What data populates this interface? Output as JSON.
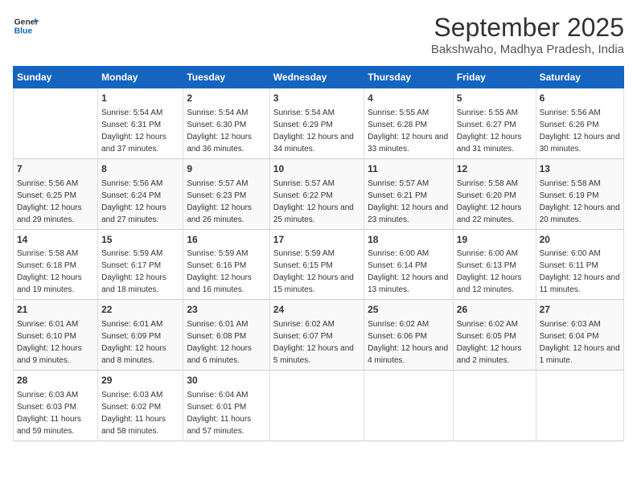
{
  "header": {
    "logo_line1": "General",
    "logo_line2": "Blue",
    "month": "September 2025",
    "location": "Bakshwaho, Madhya Pradesh, India"
  },
  "weekdays": [
    "Sunday",
    "Monday",
    "Tuesday",
    "Wednesday",
    "Thursday",
    "Friday",
    "Saturday"
  ],
  "weeks": [
    [
      {
        "day": "",
        "sunrise": "",
        "sunset": "",
        "daylight": ""
      },
      {
        "day": "1",
        "sunrise": "Sunrise: 5:54 AM",
        "sunset": "Sunset: 6:31 PM",
        "daylight": "Daylight: 12 hours and 37 minutes."
      },
      {
        "day": "2",
        "sunrise": "Sunrise: 5:54 AM",
        "sunset": "Sunset: 6:30 PM",
        "daylight": "Daylight: 12 hours and 36 minutes."
      },
      {
        "day": "3",
        "sunrise": "Sunrise: 5:54 AM",
        "sunset": "Sunset: 6:29 PM",
        "daylight": "Daylight: 12 hours and 34 minutes."
      },
      {
        "day": "4",
        "sunrise": "Sunrise: 5:55 AM",
        "sunset": "Sunset: 6:28 PM",
        "daylight": "Daylight: 12 hours and 33 minutes."
      },
      {
        "day": "5",
        "sunrise": "Sunrise: 5:55 AM",
        "sunset": "Sunset: 6:27 PM",
        "daylight": "Daylight: 12 hours and 31 minutes."
      },
      {
        "day": "6",
        "sunrise": "Sunrise: 5:56 AM",
        "sunset": "Sunset: 6:26 PM",
        "daylight": "Daylight: 12 hours and 30 minutes."
      }
    ],
    [
      {
        "day": "7",
        "sunrise": "Sunrise: 5:56 AM",
        "sunset": "Sunset: 6:25 PM",
        "daylight": "Daylight: 12 hours and 29 minutes."
      },
      {
        "day": "8",
        "sunrise": "Sunrise: 5:56 AM",
        "sunset": "Sunset: 6:24 PM",
        "daylight": "Daylight: 12 hours and 27 minutes."
      },
      {
        "day": "9",
        "sunrise": "Sunrise: 5:57 AM",
        "sunset": "Sunset: 6:23 PM",
        "daylight": "Daylight: 12 hours and 26 minutes."
      },
      {
        "day": "10",
        "sunrise": "Sunrise: 5:57 AM",
        "sunset": "Sunset: 6:22 PM",
        "daylight": "Daylight: 12 hours and 25 minutes."
      },
      {
        "day": "11",
        "sunrise": "Sunrise: 5:57 AM",
        "sunset": "Sunset: 6:21 PM",
        "daylight": "Daylight: 12 hours and 23 minutes."
      },
      {
        "day": "12",
        "sunrise": "Sunrise: 5:58 AM",
        "sunset": "Sunset: 6:20 PM",
        "daylight": "Daylight: 12 hours and 22 minutes."
      },
      {
        "day": "13",
        "sunrise": "Sunrise: 5:58 AM",
        "sunset": "Sunset: 6:19 PM",
        "daylight": "Daylight: 12 hours and 20 minutes."
      }
    ],
    [
      {
        "day": "14",
        "sunrise": "Sunrise: 5:58 AM",
        "sunset": "Sunset: 6:18 PM",
        "daylight": "Daylight: 12 hours and 19 minutes."
      },
      {
        "day": "15",
        "sunrise": "Sunrise: 5:59 AM",
        "sunset": "Sunset: 6:17 PM",
        "daylight": "Daylight: 12 hours and 18 minutes."
      },
      {
        "day": "16",
        "sunrise": "Sunrise: 5:59 AM",
        "sunset": "Sunset: 6:16 PM",
        "daylight": "Daylight: 12 hours and 16 minutes."
      },
      {
        "day": "17",
        "sunrise": "Sunrise: 5:59 AM",
        "sunset": "Sunset: 6:15 PM",
        "daylight": "Daylight: 12 hours and 15 minutes."
      },
      {
        "day": "18",
        "sunrise": "Sunrise: 6:00 AM",
        "sunset": "Sunset: 6:14 PM",
        "daylight": "Daylight: 12 hours and 13 minutes."
      },
      {
        "day": "19",
        "sunrise": "Sunrise: 6:00 AM",
        "sunset": "Sunset: 6:13 PM",
        "daylight": "Daylight: 12 hours and 12 minutes."
      },
      {
        "day": "20",
        "sunrise": "Sunrise: 6:00 AM",
        "sunset": "Sunset: 6:11 PM",
        "daylight": "Daylight: 12 hours and 11 minutes."
      }
    ],
    [
      {
        "day": "21",
        "sunrise": "Sunrise: 6:01 AM",
        "sunset": "Sunset: 6:10 PM",
        "daylight": "Daylight: 12 hours and 9 minutes."
      },
      {
        "day": "22",
        "sunrise": "Sunrise: 6:01 AM",
        "sunset": "Sunset: 6:09 PM",
        "daylight": "Daylight: 12 hours and 8 minutes."
      },
      {
        "day": "23",
        "sunrise": "Sunrise: 6:01 AM",
        "sunset": "Sunset: 6:08 PM",
        "daylight": "Daylight: 12 hours and 6 minutes."
      },
      {
        "day": "24",
        "sunrise": "Sunrise: 6:02 AM",
        "sunset": "Sunset: 6:07 PM",
        "daylight": "Daylight: 12 hours and 5 minutes."
      },
      {
        "day": "25",
        "sunrise": "Sunrise: 6:02 AM",
        "sunset": "Sunset: 6:06 PM",
        "daylight": "Daylight: 12 hours and 4 minutes."
      },
      {
        "day": "26",
        "sunrise": "Sunrise: 6:02 AM",
        "sunset": "Sunset: 6:05 PM",
        "daylight": "Daylight: 12 hours and 2 minutes."
      },
      {
        "day": "27",
        "sunrise": "Sunrise: 6:03 AM",
        "sunset": "Sunset: 6:04 PM",
        "daylight": "Daylight: 12 hours and 1 minute."
      }
    ],
    [
      {
        "day": "28",
        "sunrise": "Sunrise: 6:03 AM",
        "sunset": "Sunset: 6:03 PM",
        "daylight": "Daylight: 11 hours and 59 minutes."
      },
      {
        "day": "29",
        "sunrise": "Sunrise: 6:03 AM",
        "sunset": "Sunset: 6:02 PM",
        "daylight": "Daylight: 11 hours and 58 minutes."
      },
      {
        "day": "30",
        "sunrise": "Sunrise: 6:04 AM",
        "sunset": "Sunset: 6:01 PM",
        "daylight": "Daylight: 11 hours and 57 minutes."
      },
      {
        "day": "",
        "sunrise": "",
        "sunset": "",
        "daylight": ""
      },
      {
        "day": "",
        "sunrise": "",
        "sunset": "",
        "daylight": ""
      },
      {
        "day": "",
        "sunrise": "",
        "sunset": "",
        "daylight": ""
      },
      {
        "day": "",
        "sunrise": "",
        "sunset": "",
        "daylight": ""
      }
    ]
  ]
}
